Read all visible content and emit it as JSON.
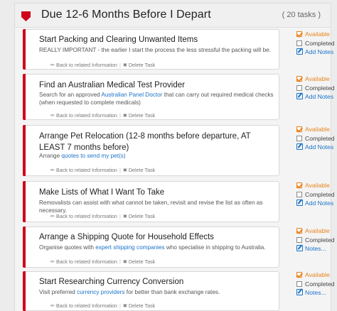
{
  "section": {
    "title": "Due 12-6 Months Before I Depart",
    "task_count": "( 20 tasks )"
  },
  "task_links": {
    "back": "Back to related Information",
    "delete": "Delete Task"
  },
  "status_labels": {
    "available": "Available",
    "completed": "Completed"
  },
  "tasks": [
    {
      "title": "Start Packing and Clearing Unwanted Items",
      "desc_before": "REALLY IMPORTANT - the earlier I start the process the less stressful the packing will be.",
      "desc_link": "",
      "desc_after": "",
      "notes_label": "Add Notes"
    },
    {
      "title": "Find an Australian Medical Test Provider",
      "desc_before": "Search for an approved ",
      "desc_link": "Australian Panel Doctor",
      "desc_after": " that can carry out required medical checks (when requested to complete medicals)",
      "notes_label": "Add Notes"
    },
    {
      "title": "Arrange Pet Relocation (12-8 months before departure, AT LEAST 7 months before)",
      "desc_before": "Arrange ",
      "desc_link": "quotes to send my pet(s)",
      "desc_after": "",
      "notes_label": "Add Notes"
    },
    {
      "title": "Make Lists of What I Want To Take",
      "desc_before": "Removalists can assist with what cannot be taken, revisit and revise the list as often as necessary.",
      "desc_link": "",
      "desc_after": "",
      "notes_label": "Add Notes"
    },
    {
      "title": "Arrange a Shipping Quote for Household Effects",
      "desc_before": "Organise quotes with ",
      "desc_link": "expert shipping companies",
      "desc_after": " who specialise in shipping to Australia.",
      "notes_label": "Notes..."
    },
    {
      "title": "Start Researching Currency Conversion",
      "desc_before": "Visit preferred ",
      "desc_link": "currency providers",
      "desc_after": " for better than bank exchange rates.",
      "notes_label": "Notes..."
    }
  ],
  "colors": {
    "accent_red": "#d0021b",
    "available_orange": "#e8831f",
    "link_blue": "#1a73c9"
  },
  "icons": {
    "section_flag": "flag-icon",
    "back_link": "pencil-icon",
    "delete_link": "x-icon",
    "notes": "edit-icon"
  }
}
